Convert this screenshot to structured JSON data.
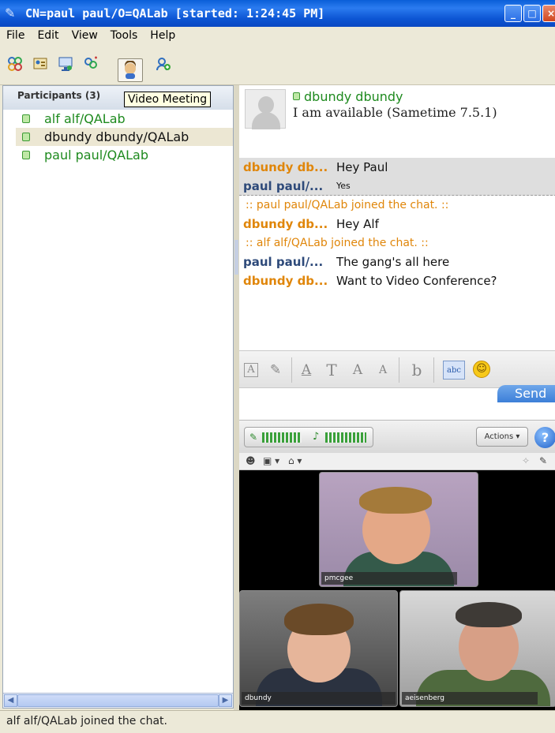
{
  "window": {
    "title": "CN=paul paul/O=QALab [started: 1:24:45 PM]"
  },
  "menu": [
    "File",
    "Edit",
    "View",
    "Tools",
    "Help"
  ],
  "toolbar": {
    "icons": [
      "group-icon",
      "contact-card-icon",
      "screen-share-icon",
      "add-people-icon",
      "video-meeting-icon",
      "add-participant-icon"
    ],
    "tooltip": "Video Meeting"
  },
  "participants": {
    "header": "Participants (3)",
    "items": [
      {
        "name": "alf alf/QALab",
        "selected": false
      },
      {
        "name": "dbundy dbundy/QALab",
        "selected": true
      },
      {
        "name": "paul paul/QALab",
        "selected": false
      }
    ]
  },
  "chat_header": {
    "name": "dbundy dbundy",
    "status": "I am available  (Sametime 7.5.1)"
  },
  "transcript": [
    {
      "kind": "msg",
      "sender": "dbundy db...",
      "sender_color": "orange",
      "text": "Hey Paul",
      "old": true
    },
    {
      "kind": "msg",
      "sender": "paul paul/...",
      "sender_color": "navy",
      "text": "Yes",
      "old": true,
      "small": true
    },
    {
      "kind": "sys",
      "text": ":: paul paul/QALab joined the chat. ::"
    },
    {
      "kind": "msg",
      "sender": "dbundy db...",
      "sender_color": "orange",
      "text": "Hey Alf"
    },
    {
      "kind": "sys",
      "text": ":: alf alf/QALab joined the chat. ::"
    },
    {
      "kind": "msg",
      "sender": "paul paul/...",
      "sender_color": "navy",
      "text": "The gang's all here"
    },
    {
      "kind": "msg",
      "sender": "dbundy db...",
      "sender_color": "orange",
      "text": "Want to Video Conference?"
    }
  ],
  "compose": {
    "send_label": "Send",
    "format_glyphs": {
      "text_box": "A",
      "pen": "✎",
      "font": "A",
      "text": "T",
      "grow": "A",
      "shrink": "A",
      "bold": "b",
      "spell": "abc",
      "emoticon": "☺"
    }
  },
  "video": {
    "actions_label": "Actions ▾",
    "help_label": "?",
    "tiles": [
      {
        "caption": "pmcgee"
      },
      {
        "caption": "dbundy"
      },
      {
        "caption": "aeisenberg"
      }
    ]
  },
  "statusbar": {
    "text": "alf alf/QALab joined the chat."
  }
}
